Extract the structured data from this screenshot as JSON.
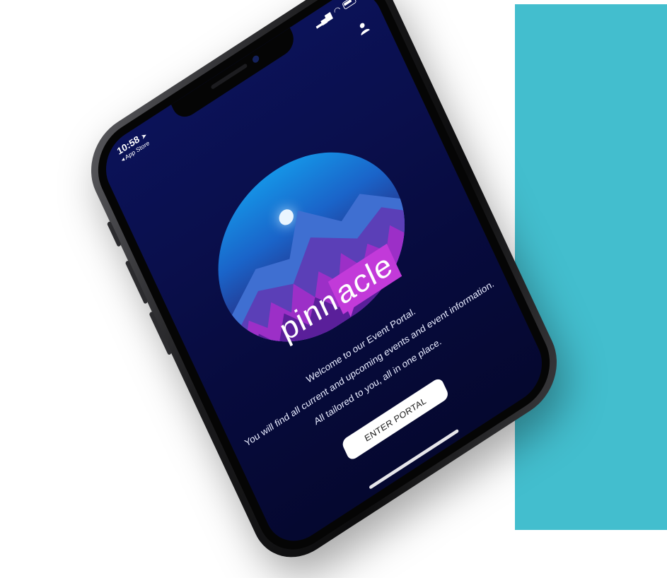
{
  "theme": {
    "teal": "#43bece",
    "magenta": "#c23ad9",
    "screen_bg": "#0a0f4c"
  },
  "status_bar": {
    "time": "10:58",
    "back_label": "◂ App Store"
  },
  "icons": {
    "location": "location-arrow-icon",
    "signal": "signal-bars-icon",
    "wifi": "wifi-icon",
    "battery": "battery-icon",
    "account": "user-icon"
  },
  "logo": {
    "part1": "pinn",
    "part2": "acle"
  },
  "welcome": {
    "line1": "Welcome to our Event Portal.",
    "line2": "You will find all current and upcoming events and event information.",
    "line3": "All tailored to you, all in one place."
  },
  "cta": {
    "label": "ENTER PORTAL"
  }
}
